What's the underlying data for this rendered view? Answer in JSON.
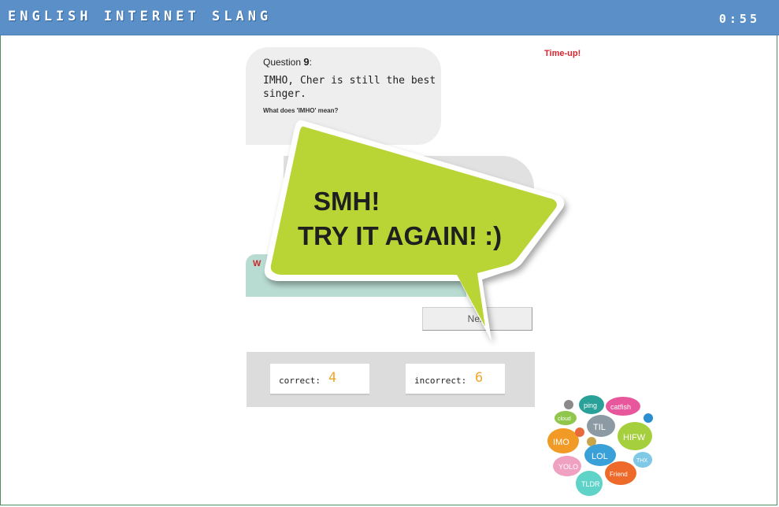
{
  "header": {
    "app_title": "English Internet Slang",
    "timer": "0:55"
  },
  "status": {
    "time_up": "Time-up!"
  },
  "question": {
    "label": "Question",
    "number": "9",
    "colon": ":",
    "text": "IMHO, Cher is still the best singer.",
    "prompt": "What does 'IMHO' mean?"
  },
  "feedback": {
    "partial": "W"
  },
  "overlay": {
    "line1": "SMH!",
    "line2": "TRY IT AGAIN! :)"
  },
  "buttons": {
    "next_label": "Next"
  },
  "score": {
    "correct_label": "correct:",
    "correct_value": "4",
    "incorrect_label": "incorrect:",
    "incorrect_value": "6"
  },
  "slang_cloud": {
    "words": [
      "ping",
      "catfish",
      "cloud",
      "TIL",
      "HIFW",
      "IMO",
      "LOL",
      "THX",
      "YOLO",
      "Friend",
      "TLDR"
    ]
  },
  "colors": {
    "header_bg": "#5a8fc7",
    "overlay_green": "#b9d535",
    "score_orange": "#f2a52b",
    "alert_red": "#d8232a"
  }
}
